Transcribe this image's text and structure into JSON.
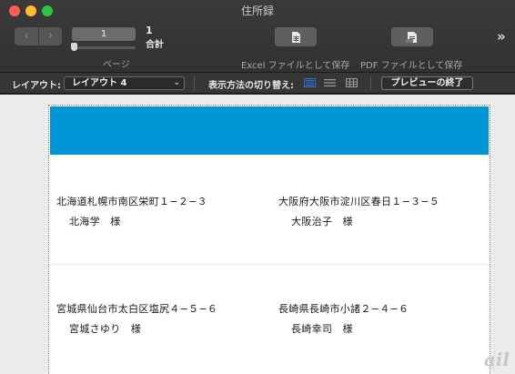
{
  "window": {
    "title": "住所録"
  },
  "toolbar": {
    "back_icon": "‹",
    "forward_icon": "›",
    "page_number": "1",
    "page_total": "1",
    "page_total_label": "合計",
    "page_label": "ページ",
    "excel_label": "Excel ファイルとして保存",
    "pdf_label": "PDF ファイルとして保存",
    "more_icon": "»"
  },
  "layout_bar": {
    "layout_label": "レイアウト:",
    "layout_value": "レイアウト 4",
    "view_label": "表示方法の切り替え:",
    "preview_end_label": "プレビューの終了"
  },
  "labels": [
    {
      "address": "北海道札幌市南区栄町１−２−３",
      "name": "北海学　様"
    },
    {
      "address": "大阪府大阪市淀川区春日１−３−５",
      "name": "大阪治子　様"
    },
    {
      "address": "宮城県仙台市太白区塩尻４−５−６",
      "name": "宮城さゆり　様"
    },
    {
      "address": "長崎県長崎市小諸２−４−６",
      "name": "長崎幸司　様"
    }
  ],
  "watermark": "ail",
  "colors": {
    "header_band": "#0096d6",
    "accent_view_icon": "#2f6fd6"
  }
}
